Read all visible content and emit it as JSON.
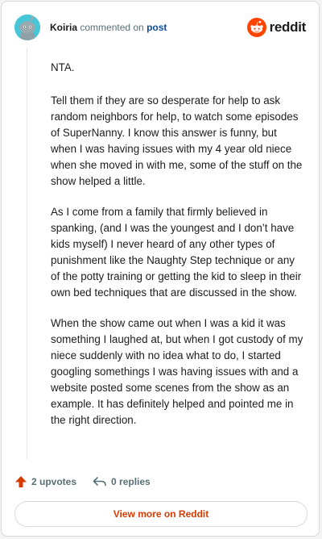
{
  "header": {
    "username": "Koiria",
    "action_text": " commented on ",
    "post_link": "post",
    "logo_text": "reddit",
    "avatar_color": "#46c6d6"
  },
  "comment": {
    "paragraphs": [
      "NTA.",
      "Tell them if they are so desperate for help to ask random neighbors for help, to watch some episodes of SuperNanny. I know this answer is funny, but when I was having issues with my 4 year old niece when she moved in with me, some of the stuff on the show helped a little.",
      "As I come from a family that firmly believed in spanking, (and I was the youngest and I don’t have kids myself) I never heard of any other types of punishment like the Naughty Step technique or any of the potty training or getting the kid to sleep in their own bed techniques that are discussed in the show.",
      "When the show came out when I was a kid it was something I laughed at, but when I got custody of my niece suddenly with no idea what to do, I started googling somethings I was having issues with and a website posted some scenes from the show as an example. It has definitely helped and pointed me in the right direction."
    ]
  },
  "footer": {
    "upvotes": "2 upvotes",
    "replies": "0 replies",
    "view_more": "View more on Reddit",
    "upvote_color": "#d93a00",
    "brand_color": "#ff4500"
  }
}
